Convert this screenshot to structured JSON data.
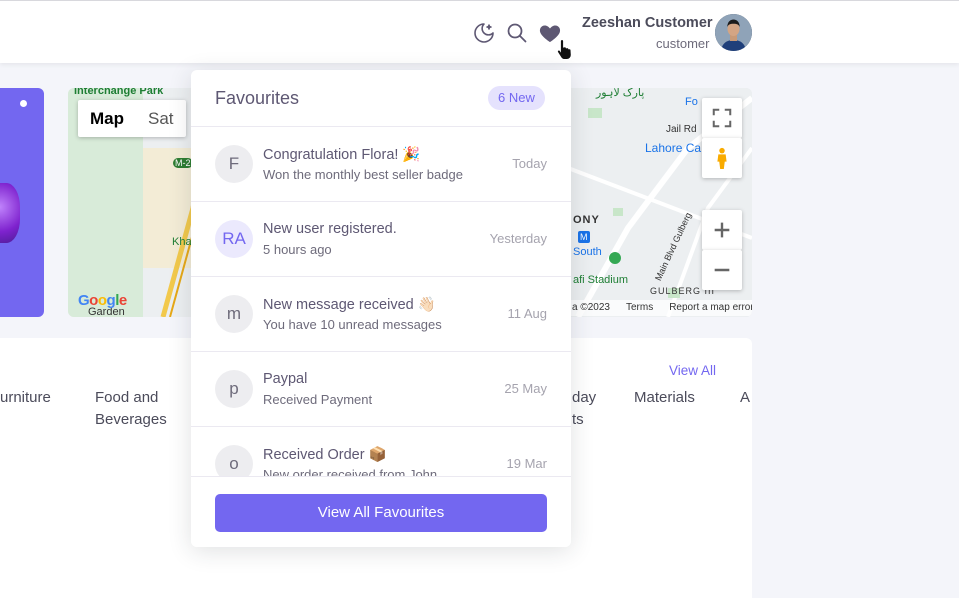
{
  "navbar": {
    "icons": [
      "moon-icon",
      "search-icon",
      "heart-icon"
    ],
    "user": {
      "name": "Zeeshan Customer",
      "role": "customer"
    }
  },
  "map": {
    "buttons": {
      "map": "Map",
      "satellite": "Sat"
    },
    "labels": {
      "interchange_park": "Interchange Park",
      "lahore_label": "Lahore Ca",
      "jail_rd": "Jail Rd",
      "fo_label": "Fo",
      "ony": "ONY",
      "south": "South",
      "stadium": "afi Stadium",
      "gulberg": "GULBERG III",
      "main_blvd": "Main Blvd Gulberg",
      "kha": "Kha",
      "garden": "Garden",
      "m2": "M-2",
      "urdu_park": "پارک لاہور",
      "metro": "M"
    },
    "footer": {
      "copyright": "a ©2023",
      "terms": "Terms",
      "report": "Report a map error"
    },
    "google": "Google"
  },
  "categories": {
    "view_all": "View All",
    "items": [
      "urniture",
      "Food and\nBeverages",
      "day\nts",
      "Materials",
      "A"
    ]
  },
  "favourites": {
    "title": "Favourites",
    "badge": "6 New",
    "items": [
      {
        "avatar": "F",
        "title": "Congratulation Flora! 🎉",
        "subtitle": "Won the monthly best seller badge",
        "time": "Today"
      },
      {
        "avatar": "RA",
        "title": "New user registered.",
        "subtitle": "5 hours ago",
        "time": "Yesterday"
      },
      {
        "avatar": "m",
        "title": "New message received 👋🏻",
        "subtitle": "You have 10 unread messages",
        "time": "11 Aug"
      },
      {
        "avatar": "p",
        "title": "Paypal",
        "subtitle": "Received Payment",
        "time": "25 May"
      },
      {
        "avatar": "o",
        "title": "Received Order 📦",
        "subtitle": "New order received from John",
        "time": "19 Mar"
      }
    ],
    "button": "View All Favourites"
  },
  "colors": {
    "primary": "#7367f0",
    "badge_bg": "#e5e2fd",
    "text": "#5e5873",
    "muted": "#a5a3ae"
  }
}
